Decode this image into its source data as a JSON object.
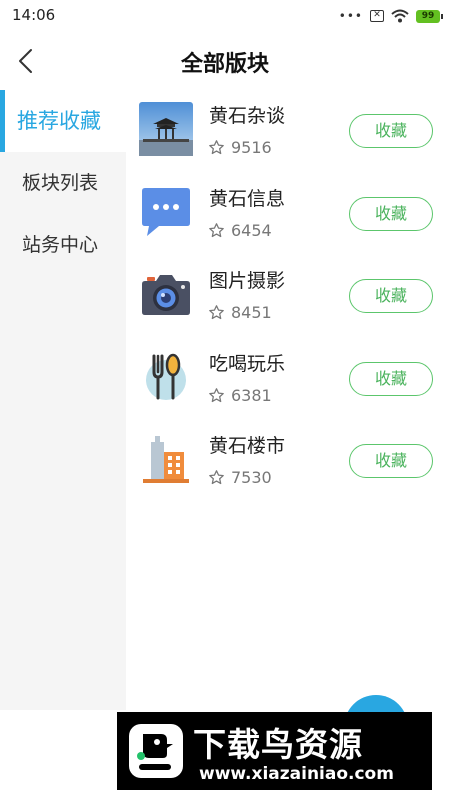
{
  "status_bar": {
    "time": "14:06",
    "battery": "99",
    "sim": "✕"
  },
  "header": {
    "title": "全部版块"
  },
  "sidebar": {
    "items": [
      {
        "label": "推荐收藏"
      },
      {
        "label": "板块列表"
      },
      {
        "label": "站务中心"
      }
    ]
  },
  "forums": [
    {
      "name": "黄石杂谈",
      "count": "9516",
      "button": "收藏",
      "icon": "pavilion-photo-icon"
    },
    {
      "name": "黄石信息",
      "count": "6454",
      "button": "收藏",
      "icon": "message-bubble-icon"
    },
    {
      "name": "图片摄影",
      "count": "8451",
      "button": "收藏",
      "icon": "camera-icon"
    },
    {
      "name": "吃喝玩乐",
      "count": "6381",
      "button": "收藏",
      "icon": "fork-spoon-icon"
    },
    {
      "name": "黄石楼市",
      "count": "7530",
      "button": "收藏",
      "icon": "buildings-icon"
    }
  ],
  "watermark": {
    "title": "下载鸟资源",
    "url": "www.xiazainiao.com"
  },
  "colors": {
    "accent": "#29a7e1",
    "button_green": "#5cc66c",
    "sidebar_bg": "#f5f5f5"
  }
}
